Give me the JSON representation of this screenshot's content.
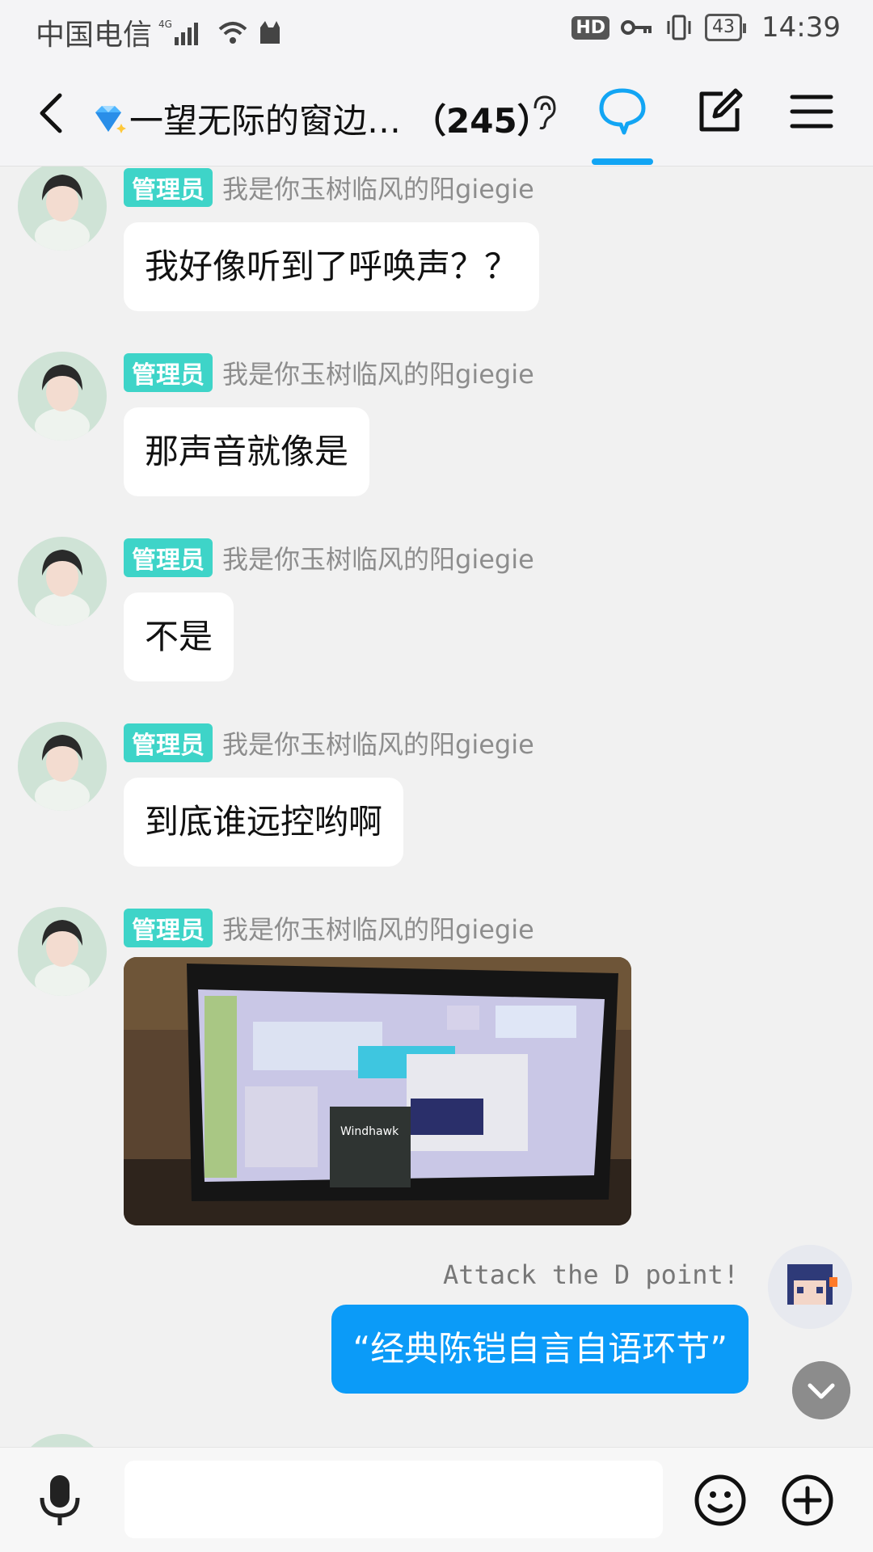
{
  "status_bar": {
    "carrier": "中国电信",
    "network": "4G",
    "hd": "HD",
    "battery": "43",
    "time": "14:39"
  },
  "header": {
    "title": "一望无际的窗边…",
    "member_count": "（245）"
  },
  "messages": [
    {
      "badge": "管理员",
      "nick": "我是你玉树临风的阳giegie",
      "text": "我好像听到了呼唤声？？"
    },
    {
      "badge": "管理员",
      "nick": "我是你玉树临风的阳giegie",
      "text": "那声音就像是"
    },
    {
      "badge": "管理员",
      "nick": "我是你玉树临风的阳giegie",
      "text": "不是"
    },
    {
      "badge": "管理员",
      "nick": "我是你玉树临风的阳giegie",
      "text": "到底谁远控哟啊"
    },
    {
      "badge": "管理员",
      "nick": "我是你玉树临风的阳giegie"
    }
  ],
  "photo": {
    "screen_text": "Windhawk"
  },
  "my_message": {
    "nick": "Attack the D point!",
    "text": "“经典陈铠自言自语环节”"
  },
  "input": {
    "placeholder": ""
  },
  "colors": {
    "accent": "#12a5f4",
    "my_bubble": "#0b9bf8",
    "badge": "#3ed4c8"
  }
}
